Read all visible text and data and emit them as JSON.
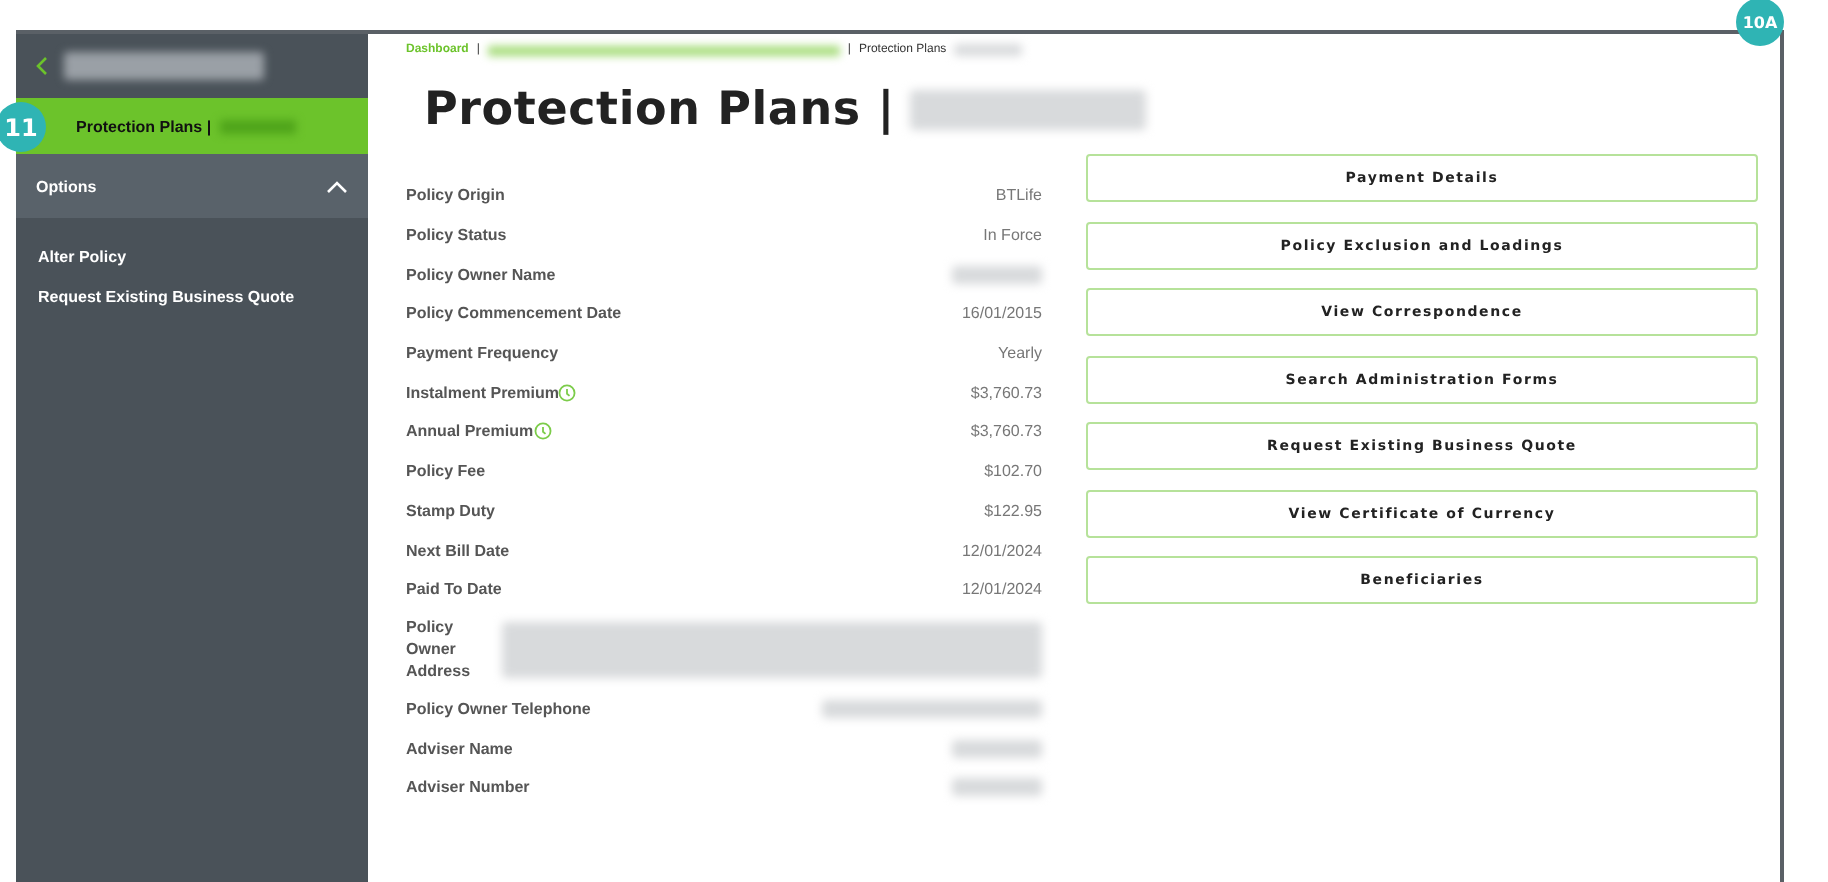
{
  "sidebar": {
    "back_header": {
      "redacted": true
    },
    "active_item": {
      "label": "Protection Plans |",
      "redacted": true
    },
    "section": {
      "label": "Options",
      "expanded": true
    },
    "items": [
      {
        "label": "Alter Policy"
      },
      {
        "label": "Request Existing Business Quote"
      }
    ]
  },
  "breadcrumb": [
    {
      "label": "Dashboard",
      "kind": "link"
    },
    {
      "label": "|",
      "kind": "separator"
    },
    {
      "kind": "redacted-link"
    },
    {
      "label": "|",
      "kind": "separator"
    },
    {
      "label": "Protection Plans",
      "kind": "current"
    }
  ],
  "page_title": {
    "label": "Protection Plans |",
    "redacted": true
  },
  "details": [
    {
      "label": "Policy Origin",
      "value": "BTLife"
    },
    {
      "label": "Policy Status",
      "value": "In Force"
    },
    {
      "label": "Policy Owner Name",
      "redacted": true
    },
    {
      "label": "Policy Commencement Date",
      "value": "16/01/2015"
    },
    {
      "label": "Payment Frequency",
      "value": "Yearly"
    },
    {
      "label": "Instalment Premium",
      "value": "$3,760.73",
      "info": true
    },
    {
      "label": "Annual Premium",
      "value": "$3,760.73",
      "info": true
    },
    {
      "label": "Policy Fee",
      "value": "$102.70"
    },
    {
      "label": "Stamp Duty",
      "value": "$122.95"
    },
    {
      "label": "Next Bill Date",
      "value": "12/01/2024"
    },
    {
      "label": "Paid To Date",
      "value": "12/01/2024"
    },
    {
      "label": "Policy Owner Address",
      "redacted": true,
      "wide": true
    },
    {
      "label": "Policy Owner Telephone",
      "redacted": true
    },
    {
      "label": "Adviser Name",
      "redacted": true
    },
    {
      "label": "Adviser Number",
      "redacted": true
    }
  ],
  "actions": [
    "Payment Details",
    "Policy Exclusion and Loadings",
    "View Correspondence",
    "Search Administration Forms",
    "Request Existing Business Quote",
    "View Certificate of Currency",
    "Beneficiaries"
  ],
  "annotations": [
    "11",
    "10A"
  ]
}
